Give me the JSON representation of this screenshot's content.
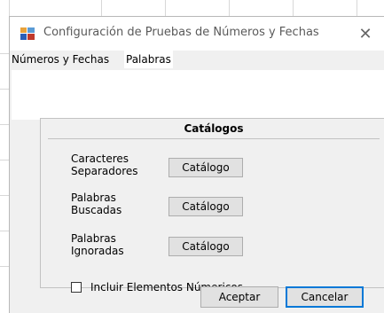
{
  "window": {
    "title": "Configuración de Pruebas de Números y Fechas",
    "icon": "form-icon",
    "close_glyph": "✕"
  },
  "tabs": [
    {
      "label": "Números y Fechas",
      "active": false
    },
    {
      "label": "Palabras",
      "active": true
    }
  ],
  "catalogos": {
    "header": "Catálogos",
    "rows": [
      {
        "label_line1": "Caracteres",
        "label_line2": "Separadores",
        "button": "Catálogo"
      },
      {
        "label_line1": "Palabras",
        "label_line2": "Buscadas",
        "button": "Catálogo"
      },
      {
        "label_line1": "Palabras",
        "label_line2": "Ignoradas",
        "button": "Catálogo"
      }
    ],
    "checkbox": {
      "label": "Incluir Elementos Númericos",
      "checked": false
    }
  },
  "footer": {
    "accept_label": "Aceptar",
    "cancel_label": "Cancelar"
  },
  "colors": {
    "accent": "#0078d7",
    "dialog_bg": "#f0f0f0",
    "button_bg": "#e1e1e1"
  }
}
